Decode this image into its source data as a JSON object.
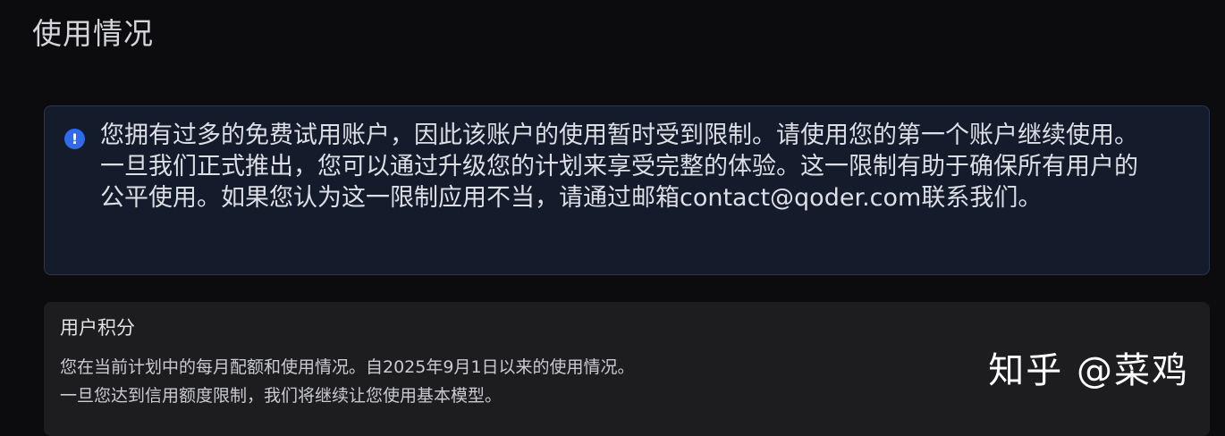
{
  "page": {
    "title": "使用情况"
  },
  "alert": {
    "icon": "info-circle-icon",
    "icon_glyph": "!",
    "lines": [
      "您拥有过多的免费试用账户，因此该账户的使用暂时受到限制。请使用您的第一个账户继续使用。",
      "一旦我们正式推出，您可以通过升级您的计划来享受完整的体验。这一限制有助于确保所有用户的",
      "公平使用。如果您认为这一限制应用不当，请通过邮箱contact@qoder.com联系我们。"
    ]
  },
  "credits": {
    "title": "用户积分",
    "description_lines": [
      "您在当前计划中的每月配额和使用情况。自2025年9月1日以来的使用情况。",
      "一旦您达到信用额度限制，我们将继续让您使用基本模型。"
    ]
  },
  "watermark": {
    "text": "知乎 @菜鸡"
  },
  "colors": {
    "background": "#0c0c0f",
    "alert_background": "#141b2a",
    "alert_border": "#2a3550",
    "info_blue": "#2f6bea",
    "card_background": "#1d1d20"
  }
}
